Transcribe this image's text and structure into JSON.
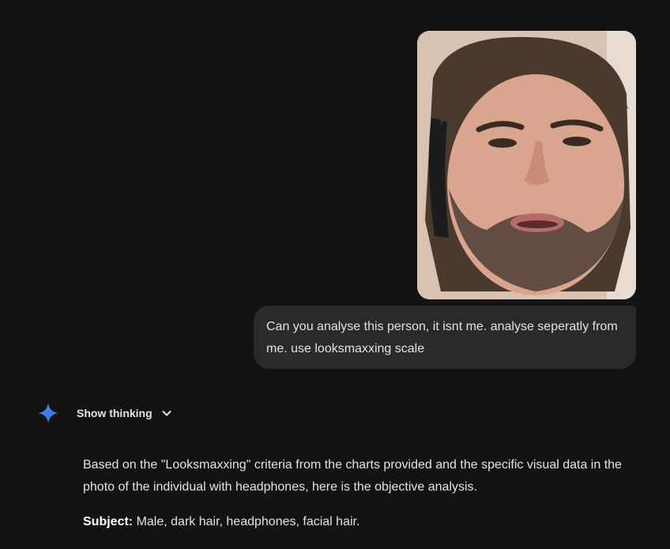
{
  "user_message": {
    "image_description_icon": "photo-attachment",
    "text": "Can you analyse this person, it isnt me. analyse seperatly from me. use looksmaxxing scale"
  },
  "assistant": {
    "icon": "gemini-spark-icon",
    "show_thinking_label": "Show thinking",
    "paragraph_1": "Based on the \"Looksmaxxing\" criteria from the charts provided and the specific visual data in the photo of the individual with headphones, here is the objective analysis.",
    "subject_label": "Subject:",
    "subject_value": " Male, dark hair, headphones, facial hair."
  },
  "colors": {
    "background": "#131314",
    "bubble": "#282a2c",
    "text": "#e3e3e3",
    "accent": "#4285f4"
  }
}
